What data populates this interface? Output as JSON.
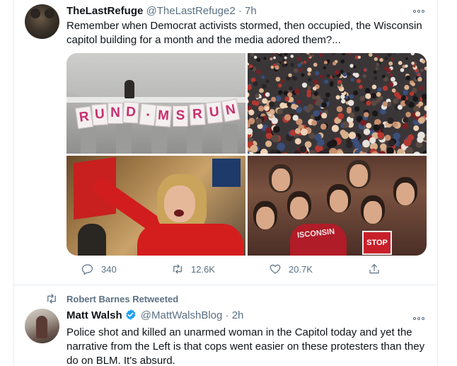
{
  "tweet1": {
    "display_name": "TheLastRefuge",
    "handle": "@TheLastRefuge2",
    "separator": "·",
    "time": "7h",
    "text": "Remember when Democrat activists stormed, then occupied, the Wisconsin capitol building for a month and the media adored them?...",
    "photo1_banner_letters": [
      "R",
      "U",
      "N",
      "D",
      "•",
      "M",
      "S",
      "R",
      "U",
      "N"
    ],
    "photo4_shirt_text": "ISCONSIN",
    "photo4_sign_text": "STOP",
    "reply_count": "340",
    "retweet_count": "12.6K",
    "like_count": "20.7K",
    "icons": {
      "reply": "reply-icon",
      "retweet": "retweet-icon",
      "like": "heart-icon",
      "share": "share-icon",
      "more": "more-icon"
    }
  },
  "tweet2": {
    "social_context": "Robert Barnes Retweeted",
    "display_name": "Matt Walsh",
    "handle": "@MattWalshBlog",
    "separator": "·",
    "time": "2h",
    "text": "Police shot and killed an unarmed woman in the Capitol today and yet the narrative from the Left is that cops went easier on these protesters than they do on BLM. It's absurd.",
    "icons": {
      "social": "retweet-icon",
      "verified": "verified-badge-icon",
      "more": "more-icon"
    }
  },
  "colors": {
    "text_primary": "#0f1419",
    "text_secondary": "#5b7083",
    "border": "#e6ecf0",
    "verified_blue": "#1da1f2"
  }
}
